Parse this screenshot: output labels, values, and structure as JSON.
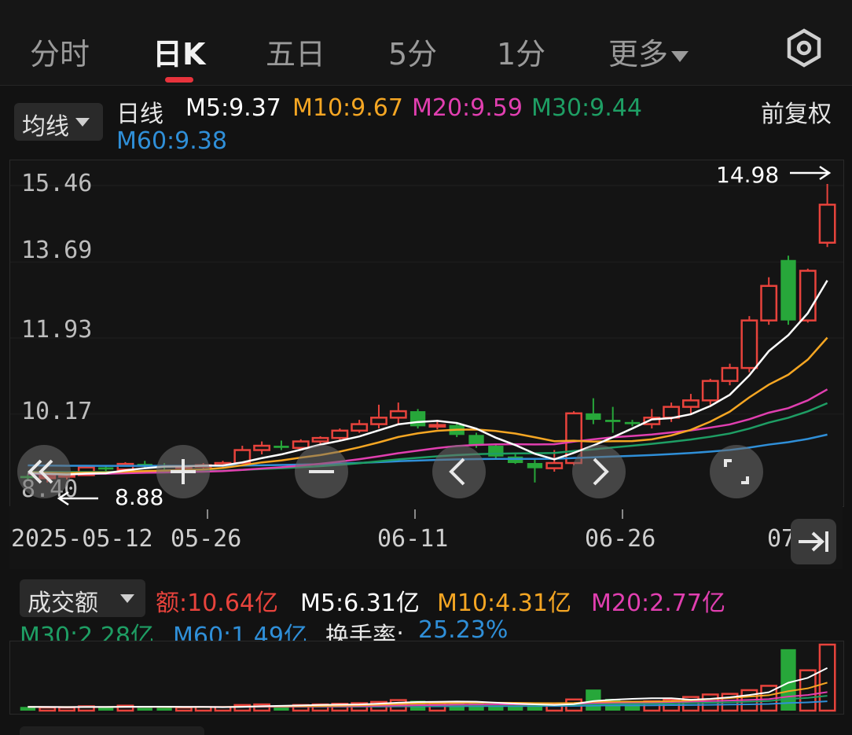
{
  "tabs": [
    {
      "label": "分时",
      "active": false
    },
    {
      "label": "日K",
      "active": true
    },
    {
      "label": "五日",
      "active": false
    },
    {
      "label": "5分",
      "active": false
    },
    {
      "label": "1分",
      "active": false
    },
    {
      "label": "更多",
      "active": false
    }
  ],
  "indicator": {
    "selector_label": "均线",
    "series_label": "日线",
    "m5": "M5:9.37",
    "m10": "M10:9.67",
    "m20": "M20:9.59",
    "m30": "M30:9.44",
    "m60": "M60:9.38",
    "adjust_label": "前复权"
  },
  "price_axis": [
    "15.46",
    "13.69",
    "11.93",
    "10.17",
    "8.40"
  ],
  "annotations": {
    "high": "14.98",
    "low": "8.88"
  },
  "dates": [
    "2025-05-12",
    "05-26",
    "06-11",
    "06-26",
    "07"
  ],
  "volume": {
    "selector_label": "成交额",
    "amount": "额:10.64亿",
    "m5": "M5:6.31亿",
    "m10": "M10:4.31亿",
    "m20": "M20:2.77亿",
    "m30": "M30:2.28亿",
    "m60": "M60:1.49亿",
    "turnover_label": "换手率:",
    "turnover_value": "25.23%"
  },
  "colors": {
    "up": "#e8433c",
    "down": "#27a73a",
    "m5": "#ffffff",
    "m10": "#f5a623",
    "m20": "#e13fb0",
    "m30": "#1e9e64",
    "m60": "#2f8fd8"
  },
  "controls": [
    "rewind-icon",
    "zoom-in-icon",
    "zoom-out-icon",
    "prev-icon",
    "next-icon",
    "fullscreen-icon",
    "jump-latest-icon"
  ],
  "chart_data": {
    "type": "candlestick",
    "price_range": [
      8.4,
      15.46
    ],
    "candles_ohlc": [
      [
        8.7,
        8.75,
        8.6,
        8.65
      ],
      [
        8.65,
        8.72,
        8.55,
        8.7
      ],
      [
        8.7,
        8.8,
        8.62,
        8.72
      ],
      [
        8.72,
        8.95,
        8.7,
        8.9
      ],
      [
        8.9,
        8.95,
        8.8,
        8.85
      ],
      [
        8.85,
        9.02,
        8.8,
        8.98
      ],
      [
        8.98,
        9.05,
        8.9,
        8.95
      ],
      [
        8.95,
        9.0,
        8.85,
        8.9
      ],
      [
        8.9,
        9.0,
        8.82,
        8.92
      ],
      [
        8.92,
        9.0,
        8.86,
        8.95
      ],
      [
        8.95,
        9.05,
        8.9,
        9.0
      ],
      [
        9.0,
        9.4,
        8.98,
        9.3
      ],
      [
        9.3,
        9.5,
        9.2,
        9.4
      ],
      [
        9.4,
        9.52,
        9.3,
        9.35
      ],
      [
        9.35,
        9.55,
        9.3,
        9.5
      ],
      [
        9.5,
        9.62,
        9.4,
        9.58
      ],
      [
        9.58,
        9.8,
        9.5,
        9.75
      ],
      [
        9.75,
        10.0,
        9.7,
        9.9
      ],
      [
        9.9,
        10.35,
        9.8,
        10.05
      ],
      [
        10.05,
        10.4,
        9.9,
        10.2
      ],
      [
        10.2,
        10.25,
        9.8,
        9.85
      ],
      [
        9.85,
        10.0,
        9.78,
        9.88
      ],
      [
        9.88,
        9.95,
        9.6,
        9.65
      ],
      [
        9.65,
        9.7,
        9.35,
        9.4
      ],
      [
        9.4,
        9.45,
        9.08,
        9.15
      ],
      [
        9.15,
        9.2,
        8.98,
        9.0
      ],
      [
        9.0,
        9.1,
        8.55,
        8.88
      ],
      [
        8.88,
        9.3,
        8.8,
        9.0
      ],
      [
        9.0,
        10.2,
        8.95,
        10.15
      ],
      [
        10.15,
        10.5,
        9.9,
        10.0
      ],
      [
        10.0,
        10.3,
        9.7,
        9.95
      ],
      [
        9.95,
        10.0,
        9.85,
        9.9
      ],
      [
        9.9,
        10.25,
        9.8,
        10.05
      ],
      [
        10.05,
        10.4,
        9.95,
        10.3
      ],
      [
        10.3,
        10.6,
        10.15,
        10.45
      ],
      [
        10.45,
        10.95,
        10.35,
        10.9
      ],
      [
        10.9,
        11.3,
        10.8,
        11.2
      ],
      [
        11.2,
        12.4,
        11.1,
        12.3
      ],
      [
        12.3,
        13.3,
        12.2,
        13.1
      ],
      [
        13.7,
        13.8,
        12.2,
        12.3
      ],
      [
        12.3,
        13.5,
        12.25,
        13.45
      ],
      [
        14.1,
        15.46,
        14.0,
        14.98
      ]
    ],
    "volume_100m": [
      0.6,
      0.5,
      0.5,
      0.7,
      0.6,
      0.8,
      0.6,
      0.5,
      0.5,
      0.6,
      0.6,
      0.9,
      1.0,
      0.8,
      0.9,
      1.0,
      1.1,
      1.2,
      1.4,
      1.7,
      1.6,
      1.2,
      1.5,
      1.2,
      0.9,
      0.8,
      0.7,
      1.0,
      1.8,
      3.4,
      1.9,
      1.4,
      1.5,
      1.8,
      2.2,
      2.6,
      2.7,
      3.3,
      4.0,
      9.9,
      6.5,
      10.64
    ]
  }
}
